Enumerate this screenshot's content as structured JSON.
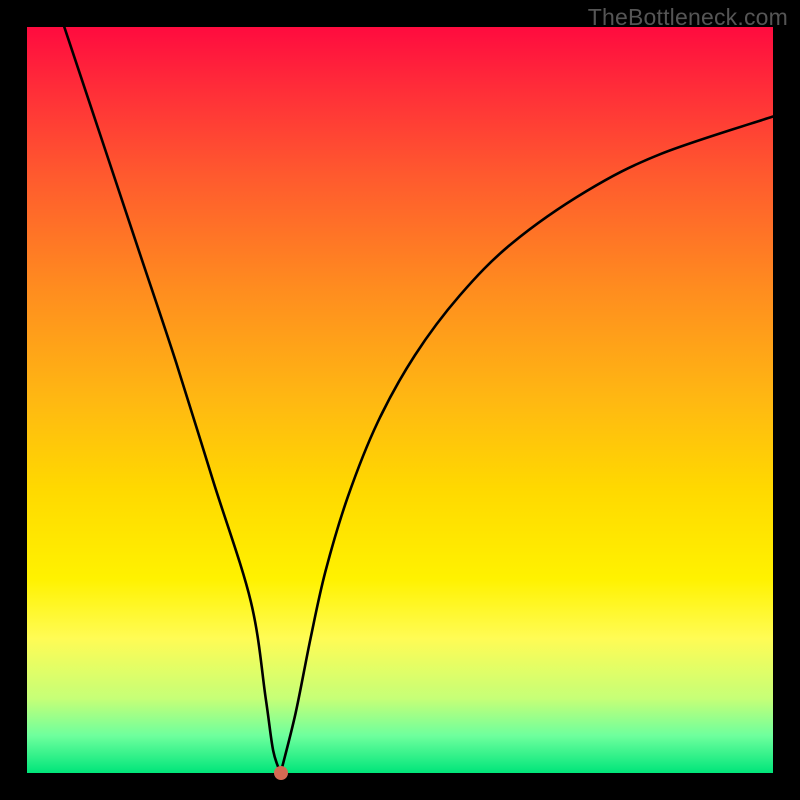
{
  "watermark": "TheBottleneck.com",
  "chart_data": {
    "type": "line",
    "title": "",
    "xlabel": "",
    "ylabel": "",
    "xlim": [
      0,
      100
    ],
    "ylim": [
      0,
      100
    ],
    "grid": false,
    "legend": false,
    "series": [
      {
        "name": "left-branch",
        "x": [
          5,
          10,
          15,
          20,
          25,
          30,
          32,
          33,
          34
        ],
        "values": [
          100,
          85,
          70,
          55,
          39,
          23,
          10,
          3,
          0
        ]
      },
      {
        "name": "right-branch",
        "x": [
          34,
          36,
          38,
          40,
          43,
          47,
          52,
          58,
          65,
          75,
          85,
          100
        ],
        "values": [
          0,
          8,
          18,
          27,
          37,
          47,
          56,
          64,
          71,
          78,
          83,
          88
        ]
      }
    ],
    "marker": {
      "x": 34,
      "y": 0,
      "color": "#d46a53"
    },
    "background_gradient": {
      "top": "#ff0b3f",
      "bottom": "#00e57a"
    }
  }
}
